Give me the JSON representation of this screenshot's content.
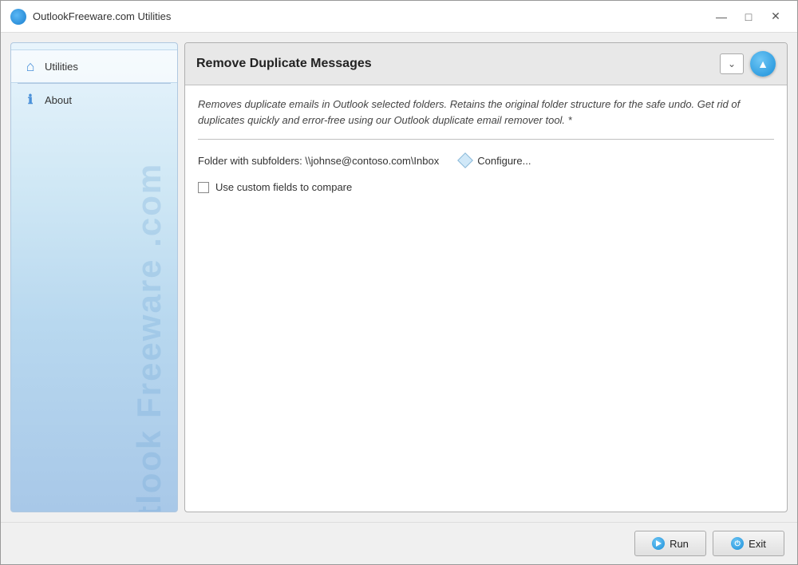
{
  "window": {
    "title": "OutlookFreeware.com Utilities"
  },
  "sidebar": {
    "items": [
      {
        "id": "utilities",
        "label": "Utilities",
        "icon": "home",
        "active": true
      },
      {
        "id": "about",
        "label": "About",
        "icon": "info",
        "active": false
      }
    ],
    "watermark": "Outlook Freeware .com"
  },
  "panel": {
    "title": "Remove Duplicate Messages",
    "description": "Removes duplicate emails in Outlook selected folders. Retains the original folder structure for the safe undo. Get rid of duplicates quickly and error-free using our Outlook duplicate email remover tool. *",
    "folder_label": "Folder with subfolders: \\\\johnse@contoso.com\\Inbox",
    "configure_label": "Configure...",
    "checkbox_label": "Use custom fields to compare"
  },
  "footer": {
    "run_label": "Run",
    "exit_label": "Exit"
  },
  "titlebar": {
    "minimize": "—",
    "maximize": "□",
    "close": "✕"
  }
}
